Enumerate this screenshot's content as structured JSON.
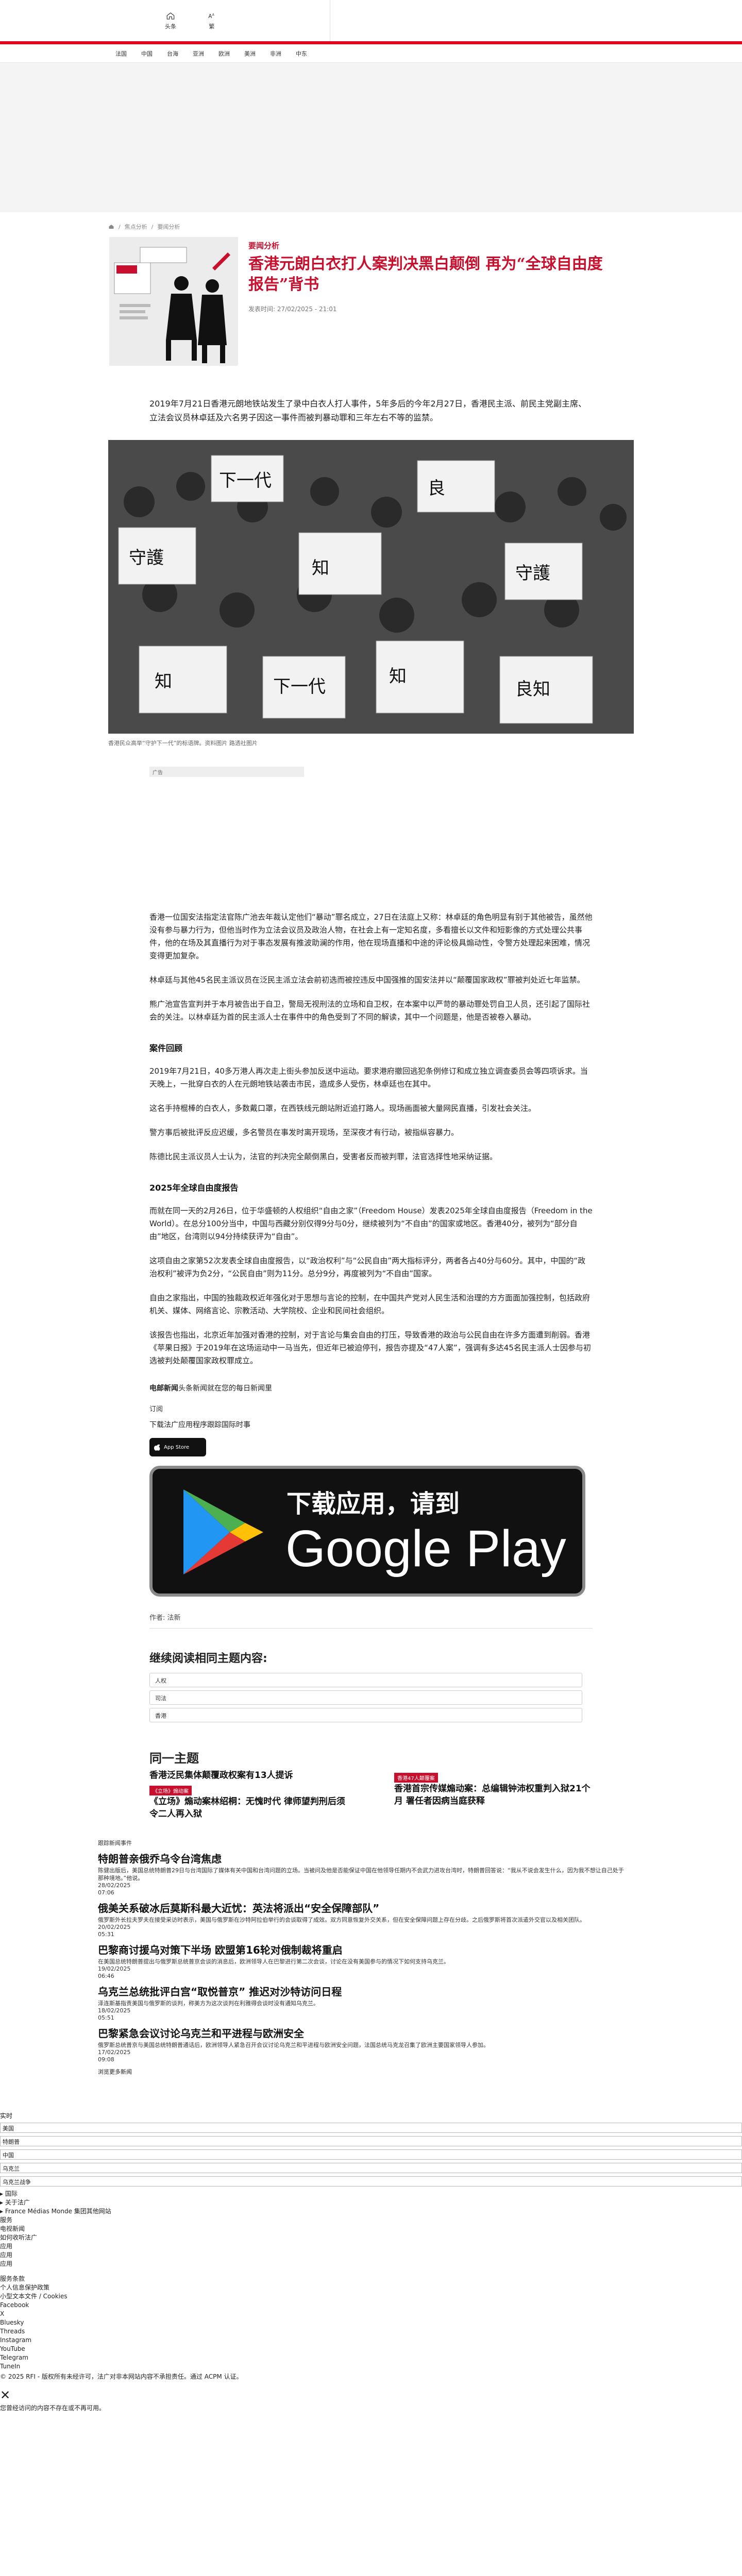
{
  "top": {
    "icons": [
      {
        "name": "home-icon",
        "label": "头条"
      },
      {
        "name": "font-size-icon",
        "label": "繁"
      }
    ]
  },
  "nav": [
    "法国",
    "中国",
    "台海",
    "亚洲",
    "欧洲",
    "美洲",
    "非洲",
    "中东"
  ],
  "breadcrumb": [
    "焦点分析",
    "要闻分析"
  ],
  "article": {
    "kicker": "要闻分析",
    "title": "香港元朗白衣打人案判决黑白颠倒 再为“全球自由度报告”背书",
    "date": "发表时间: 27/02/2025 - 21:01",
    "lead": "2019年7月21日香港元朗地铁站发生了录中白衣人打人事件，5年多后的今年2月27日，香港民主派、前民主党副主席、立法会议员林卓廷及六名男子因这一事件而被判暴动罪和三年左右不等的监禁。",
    "image_caption": "香港民众高举“守护下一代”的标语牌。资料图片 路透社图片",
    "ad_label": "广告",
    "paragraphs": [
      "香港一位国安法指定法官陈广池去年裁认定他们“暴动”罪名成立，27日在法庭上又称：林卓廷的角色明显有别于其他被告，虽然他没有参与暴力行为，但他当时作为立法会议员及政治人物，在社会上有一定知名度，多看擅长以文件和短影像的方式处理公共事件，他的在场及其直播行为对于事态发展有推波助澜的作用，他在现场直播和中途的评论极具煽动性，令警方处理起来困难，情况变得更加复杂。",
      "林卓廷与其他45名民主派议员在泛民主派立法会前初选而被控违反中国强推的国安法并以“颠覆国家政权”罪被判处近七年监禁。",
      "熊广池宣告宣判并于本月被告出于自卫，警局无视刑法的立场和自卫权，在本案中以严苛的暴动罪处罚自卫人员，还引起了国际社会的关注。以林卓廷为首的民主派人士在事件中的角色受到了不同的解读，其中一个问题是，他是否被卷入暴动。",
      "案件回顾",
      "2019年7月21日，40多万港人再次走上街头参加反送中运动。要求港府撤回逃犯条例修订和成立独立调查委员会等四项诉求。当天晚上，一批穿白衣的人在元朗地铁站袭击市民，造成多人受伤，林卓廷也在其中。",
      "这名手持棍棒的白衣人，多数戴口罩，在西铁线元朗站附近追打路人。现场画面被大量网民直播，引发社会关注。",
      "警方事后被批评反应迟缓，多名警员在事发时离开现场，至深夜才有行动，被指纵容暴力。",
      "陈德比民主派议员人士认为，法官的判决完全颠倒黑白，受害者反而被判罪，法官选择性地采纳证据。",
      "2025年全球自由度报告",
      "而就在同一天的2月26日，位于华盛顿的人权组织“自由之家”（Freedom House）发表2025年全球自由度报告（Freedom in the World）。在总分100分当中，中国与西藏分别仅得9分与0分，继续被列为“不自由”的国家或地区。香港40分，被列为“部分自由”地区，台湾则以94分持续获评为“自由”。",
      "这项自由之家第52次发表全球自由度报告，以“政治权利”与“公民自由”两大指标评分，两者各占40分与60分。其中，中国的“政治权利”被评为负2分，“公民自由”则为11分。总分9分，再度被列为“不自由”国家。",
      "自由之家指出，中国的独裁政权近年强化对于思想与言论的控制，在中国共产党对人民生活和治理的方方面面加强控制，包括政府机关、媒体、网络言论、宗教活动、大学院校、企业和民间社会组织。",
      "该报告也指出，北京近年加强对香港的控制，对于言论与集会自由的打压，导致香港的政治与公民自由在许多方面遭到削弱。香港《苹果日报》于2019年在这场运动中一马当先，但近年已被迫停刊，报告亦提及“47人案”，强调有多达45名民主派人士因参与初选被判处颠覆国家政权罪成立。"
    ],
    "byline_bold": "电邮新闻",
    "byline_rest": "头条新闻就在您的每日新闻里",
    "subscribe": "订阅",
    "download_note": "下载法广应用程序跟踪国际时事",
    "appstore_label": "App Store",
    "gplay_line1": "下载应用，请到",
    "gplay_line2": "Google Play",
    "author": "作者:    法新"
  },
  "more": {
    "title": "继续阅读相同主题内容:",
    "tags": [
      "人权",
      "司法",
      "香港"
    ]
  },
  "same_topic": {
    "title": "同一主题",
    "left_headline": "香港泛民集体颠覆政权案有13人提诉",
    "left_badge": "《立场》煽动案",
    "left2_headline": "《立场》煽动案林绍桐：无愧时代 律师望判刑后须令二人再入狱",
    "right_badge": "香港47人颠覆案",
    "right_headline": "香港首宗传媒煽动案：总编辑钟沛权重判入狱21个月 署任者因病当庭获释"
  },
  "breaking": {
    "label": "跟踪新闻事件",
    "items": [
      {
        "title": "特朗普亲俄乔乌令台湾焦虑",
        "desc": "陈健出版后，美国总统特朗普29日与台湾国际了媒体有关中国和台湾问题的立场。当被问及他是否能保证中国在他领导任期内不会武力进攻台湾时，特朗普回答说：“我从不说会发生什么，因为我不想让自己处于那种境地。”他说。",
        "ts": "28/02/2025\n07:06"
      },
      {
        "title": "俄美关系破冰后莫斯科最大近忧：英法将派出“安全保障部队”",
        "desc": "俄罗斯外长拉夫罗夫在接受采访时表示，美国与俄罗斯在沙特阿拉伯举行的会谈取得了成效。双方同意恢复外交关系，但在安全保障问题上存在分歧。之后俄罗斯将首次派遣外交官以及相关团队。",
        "ts": "20/02/2025\n05:31"
      },
      {
        "title": "巴黎商讨援乌对策下半场 欧盟第16轮对俄制裁将重启",
        "desc": "在美国总统特朗普提出与俄罗斯总统普京会谈的消息后，欧洲领导人在巴黎进行第二次会谈，讨论在没有美国参与的情况下如何支持乌克兰。",
        "ts": "19/02/2025\n06:46"
      },
      {
        "title": "乌克兰总统批评白宫“取悦普京” 推迟对沙特访问日程",
        "desc": "泽连斯基指责美国与俄罗斯的谈判，称美方为这次谈判在利雅得会谈时没有通知乌克兰。",
        "ts": "18/02/2025\n05:51"
      },
      {
        "title": "巴黎紧急会议讨论乌克兰和平进程与欧洲安全",
        "desc": "俄罗斯总统普京与美国总统特朗普通话后，欧洲领导人紧急召开会议讨论乌克兰和平进程与欧洲安全问题，法国总统马克龙召集了欧洲主要国家领导人参加。",
        "ts": "17/02/2025\n09:08"
      }
    ],
    "all_news": "浏览更多新闻"
  },
  "footer": {
    "rows_top": [
      "实时"
    ],
    "select_value": "美国",
    "select_items": [
      "特朗普",
      "中国",
      "乌克兰",
      "乌克兰战争"
    ],
    "links1": [
      "▸ 国际",
      "▸ 关于法广",
      "▸ France Médias Monde 集团其他网站"
    ],
    "links2": [
      "服务",
      "电视新闻",
      "如何收听法广",
      "应用",
      "应用",
      "应用"
    ],
    "links3": [
      "服务条款",
      "个人信息保护政策",
      "小型文本文件 / Cookies",
      "Facebook",
      "X",
      "Bluesky",
      "Threads",
      "Instagram",
      "YouTube",
      "Telegram",
      "TuneIn"
    ],
    "copyright": "© 2025 RFI - 版权所有未经许可，法广对非本网站内容不承担责任。通过 ACPM 认证。",
    "close_symbol": "✕",
    "close_note": "您曾经访问的内容不存在或不再可用。"
  }
}
